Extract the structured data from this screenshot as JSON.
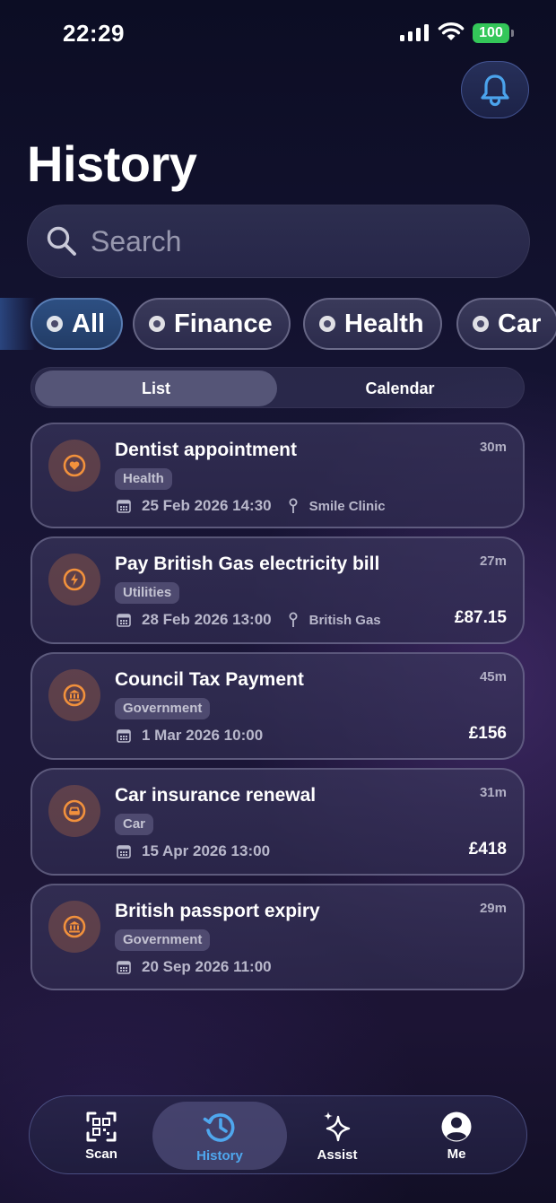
{
  "status_bar": {
    "time": "22:29",
    "battery": "100",
    "icons": [
      "signal-icon",
      "wifi-icon",
      "battery-icon"
    ]
  },
  "header": {
    "title": "History",
    "bell_icon": "bell-icon"
  },
  "search": {
    "placeholder": "Search",
    "value": "",
    "icon": "search-icon"
  },
  "filters": [
    {
      "label": "All",
      "active": true
    },
    {
      "label": "Finance",
      "active": false
    },
    {
      "label": "Health",
      "active": false
    },
    {
      "label": "Car",
      "active": false
    }
  ],
  "view_toggle": {
    "list_label": "List",
    "calendar_label": "Calendar",
    "selected": "List"
  },
  "items": [
    {
      "title": "Dentist appointment",
      "tag": "Health",
      "date": "25 Feb 2026 14:30",
      "location": "Smile Clinic",
      "amount": "",
      "duration": "30m",
      "icon": "heart-icon"
    },
    {
      "title": "Pay British Gas electricity bill",
      "tag": "Utilities",
      "date": "28 Feb 2026 13:00",
      "location": "British Gas",
      "amount": "£87.15",
      "duration": "27m",
      "icon": "lightning-icon"
    },
    {
      "title": "Council Tax Payment",
      "tag": "Government",
      "date": "1 Mar 2026 10:00",
      "location": "",
      "amount": "£156",
      "duration": "45m",
      "icon": "bank-icon"
    },
    {
      "title": "Car insurance renewal",
      "tag": "Car",
      "date": "15 Apr 2026 13:00",
      "location": "",
      "amount": "£418",
      "duration": "31m",
      "icon": "car-icon"
    },
    {
      "title": "British passport expiry",
      "tag": "Government",
      "date": "20 Sep 2026 11:00",
      "location": "",
      "amount": "",
      "duration": "29m",
      "icon": "bank-icon"
    }
  ],
  "bottom_nav": {
    "items": [
      {
        "label": "Scan",
        "icon": "qr-scan-icon"
      },
      {
        "label": "History",
        "icon": "history-icon",
        "active": true
      },
      {
        "label": "Assist",
        "icon": "sparkles-icon"
      },
      {
        "label": "Me",
        "icon": "person-icon"
      }
    ]
  },
  "colors": {
    "accent": "#4fa7ee",
    "card_icon": "#f2913c",
    "battery": "#34c759"
  }
}
